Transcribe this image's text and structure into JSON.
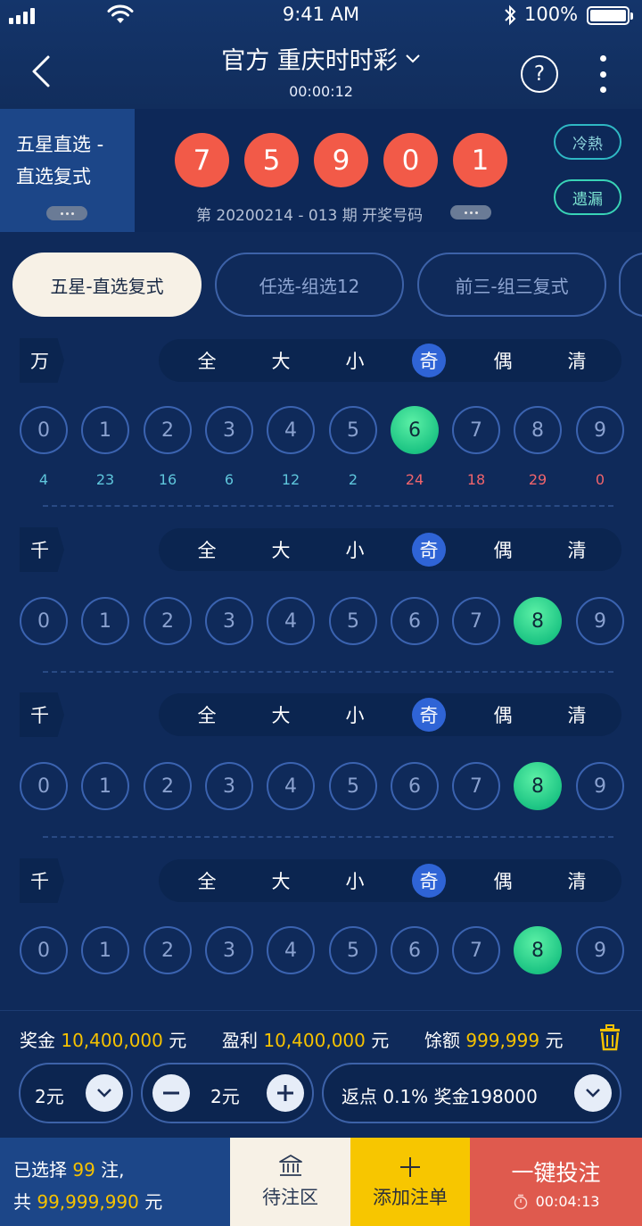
{
  "status_bar": {
    "time": "9:41 AM",
    "battery": "100%"
  },
  "header": {
    "title": "官方 重庆时时彩",
    "countdown": "00:00:12"
  },
  "play_mode": {
    "line1": "五星直选 -",
    "line2": "直选复式"
  },
  "draw": {
    "numbers": [
      "7",
      "5",
      "9",
      "0",
      "1"
    ],
    "issue_text": "第 20200214 - 013 期 开奖号码"
  },
  "side_buttons": {
    "hot_cold": "冷熱",
    "missing": "遗漏"
  },
  "tabs": [
    "五星-直选复式",
    "任选-组选12",
    "前三-组三复式"
  ],
  "quick_picks": [
    "全",
    "大",
    "小",
    "奇",
    "偶",
    "清"
  ],
  "rows": [
    {
      "label": "万",
      "active_quick": 3,
      "selected": 6,
      "stats": [
        "4",
        "23",
        "16",
        "6",
        "12",
        "2",
        "24",
        "18",
        "29",
        "0"
      ]
    },
    {
      "label": "千",
      "active_quick": 3,
      "selected": 8
    },
    {
      "label": "千",
      "active_quick": 3,
      "selected": 8
    },
    {
      "label": "千",
      "active_quick": 3,
      "selected": 8
    }
  ],
  "digits": [
    "0",
    "1",
    "2",
    "3",
    "4",
    "5",
    "6",
    "7",
    "8",
    "9"
  ],
  "summary": {
    "prize_label": "奖金",
    "prize_value": "10,400,000",
    "prize_unit": "元",
    "profit_label": "盈利",
    "profit_value": "10,400,000",
    "profit_unit": "元",
    "balance_label": "馀额",
    "balance_value": "999,999",
    "balance_unit": "元"
  },
  "controls": {
    "unit": "2元",
    "amount": "2元",
    "rebate": "返点 0.1% 奖金198000"
  },
  "bottom_bar": {
    "selected_prefix": "已选择",
    "selected_count": "99",
    "selected_suffix": "注,",
    "total_prefix": "共",
    "total_value": "99,999,990",
    "total_unit": "元",
    "pending": "待注区",
    "add": "添加注单",
    "bet": "一键投注",
    "bet_timer": "00:04:13"
  },
  "colors": {
    "background": "#0f2a5a",
    "draw_ball": "#f25a48",
    "selected_ball": "#1dc584",
    "accent_yellow": "#f6c200",
    "bet_button": "#df5a4e"
  }
}
